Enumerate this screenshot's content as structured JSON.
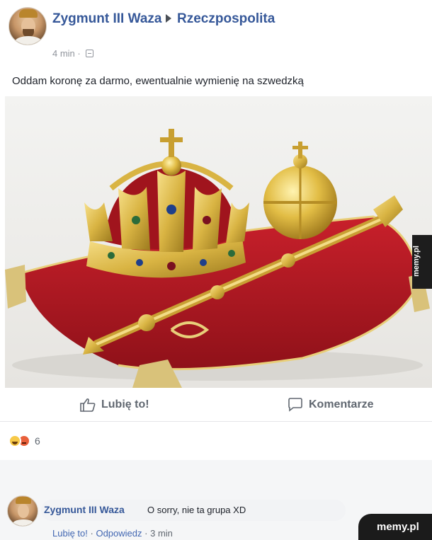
{
  "post": {
    "author": "Zygmunt III Waza",
    "group": "Rzeczpospolita",
    "time": "4 min",
    "separator": "·",
    "text": "Oddam koronę za darmo, ewentualnie wymienię na szwedzką"
  },
  "image": {
    "watermark": "memy.pl"
  },
  "actions": {
    "like_label": "Lubię to!",
    "comment_label": "Komentarze"
  },
  "reactions": {
    "count": "6"
  },
  "comment": {
    "author": "Zygmunt III Waza",
    "text": "O sorry, nie ta grupa XD",
    "like_link": "Lubię to!",
    "reply_link": "Odpowiedz",
    "time": "3 min",
    "separator": "·"
  },
  "footer": {
    "site": "memy.pl"
  },
  "colors": {
    "link_blue": "#365899",
    "cushion_red": "#b3202a",
    "gold": "#d9b443"
  }
}
